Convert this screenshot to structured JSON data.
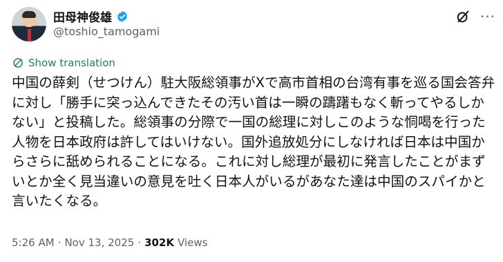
{
  "author": {
    "display_name": "田母神俊雄",
    "handle": "@toshio_tamogami"
  },
  "actions": {
    "grok_icon": "grok-icon",
    "more_label": "···"
  },
  "translate": {
    "label": "Show translation"
  },
  "tweet": {
    "text": "中国の薛剣（せつけん）駐大阪総領事がXで高市首相の台湾有事を巡る国会答弁に対し「勝手に突っ込んできたその汚い首は一瞬の躊躇もなく斬ってやるしかない」と投稿した。総領事の分際で一国の総理に対しこのような恫喝を行った人物を日本政府は許してはいけない。国外追放処分にしなければ日本は中国からさらに舐められることになる。これに対し総理が最初に発言したことがまずいとか全く見当違いの意見を吐く日本人がいるがあなた達は中国のスパイかと言いたくなる。"
  },
  "meta": {
    "time": "5:26 AM",
    "separator1": "·",
    "date": "Nov 13, 2025",
    "separator2": "·",
    "views_count": "302K",
    "views_label": "Views"
  },
  "colors": {
    "text": "#0f1419",
    "secondary": "#536471",
    "translate": "#1a8a4a",
    "verified": "#1d9bf0"
  }
}
